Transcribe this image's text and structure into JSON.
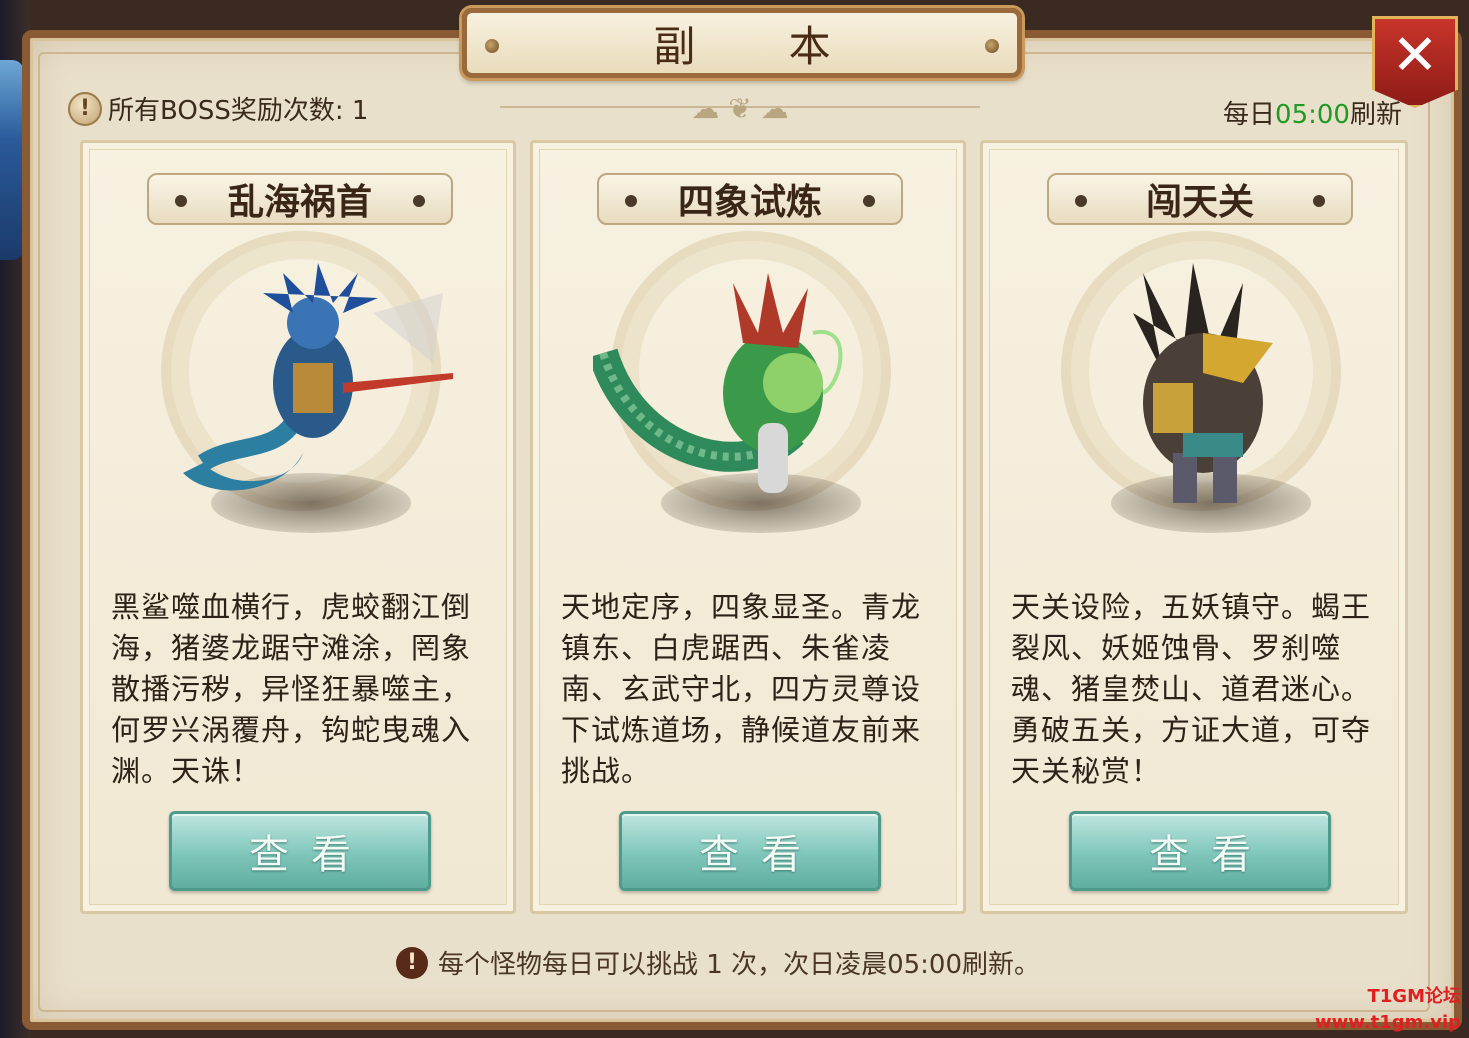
{
  "window": {
    "title": "副 本"
  },
  "header": {
    "boss_reward_label": "所有BOSS奖励次数: 1",
    "refresh_prefix": "每日",
    "refresh_time": "05:00",
    "refresh_suffix": "刷新"
  },
  "cards": [
    {
      "title": "乱海祸首",
      "description": "黑鲨噬血横行，虎蛟翻江倒海，猪婆龙踞守滩涂，罔象散播污秽，异怪狂暴噬主，何罗兴涡覆舟，钩蛇曳魂入渊。天诛！",
      "button": "查看",
      "monster_icon": "sea-dragon-boss",
      "monster_color": "#2a6aa8"
    },
    {
      "title": "四象试炼",
      "description": "天地定序，四象显圣。青龙镇东、白虎踞西、朱雀凌南、玄武守北，四方灵尊设下试炼道场，静候道友前来挑战。",
      "button": "查看",
      "monster_icon": "green-serpent-boss",
      "monster_color": "#2e8a4a"
    },
    {
      "title": "闯天关",
      "description": "天关设险，五妖镇守。蝎王裂风、妖姬蚀骨、罗刹噬魂、猪皇焚山、道君迷心。勇破五关，方证大道，可夺天关秘赏！",
      "button": "查看",
      "monster_icon": "armored-beast-boss",
      "monster_color": "#5a4a3a"
    }
  ],
  "footer": {
    "note": "每个怪物每日可以挑战 1 次，次日凌晨05:00刷新。"
  },
  "watermark": {
    "line1": "T1GM论坛",
    "line2": "www.t1gm.vip"
  },
  "colors": {
    "accent_green": "#1f9a22",
    "button_teal": "#7fc6ba",
    "close_red": "#c8352a"
  }
}
